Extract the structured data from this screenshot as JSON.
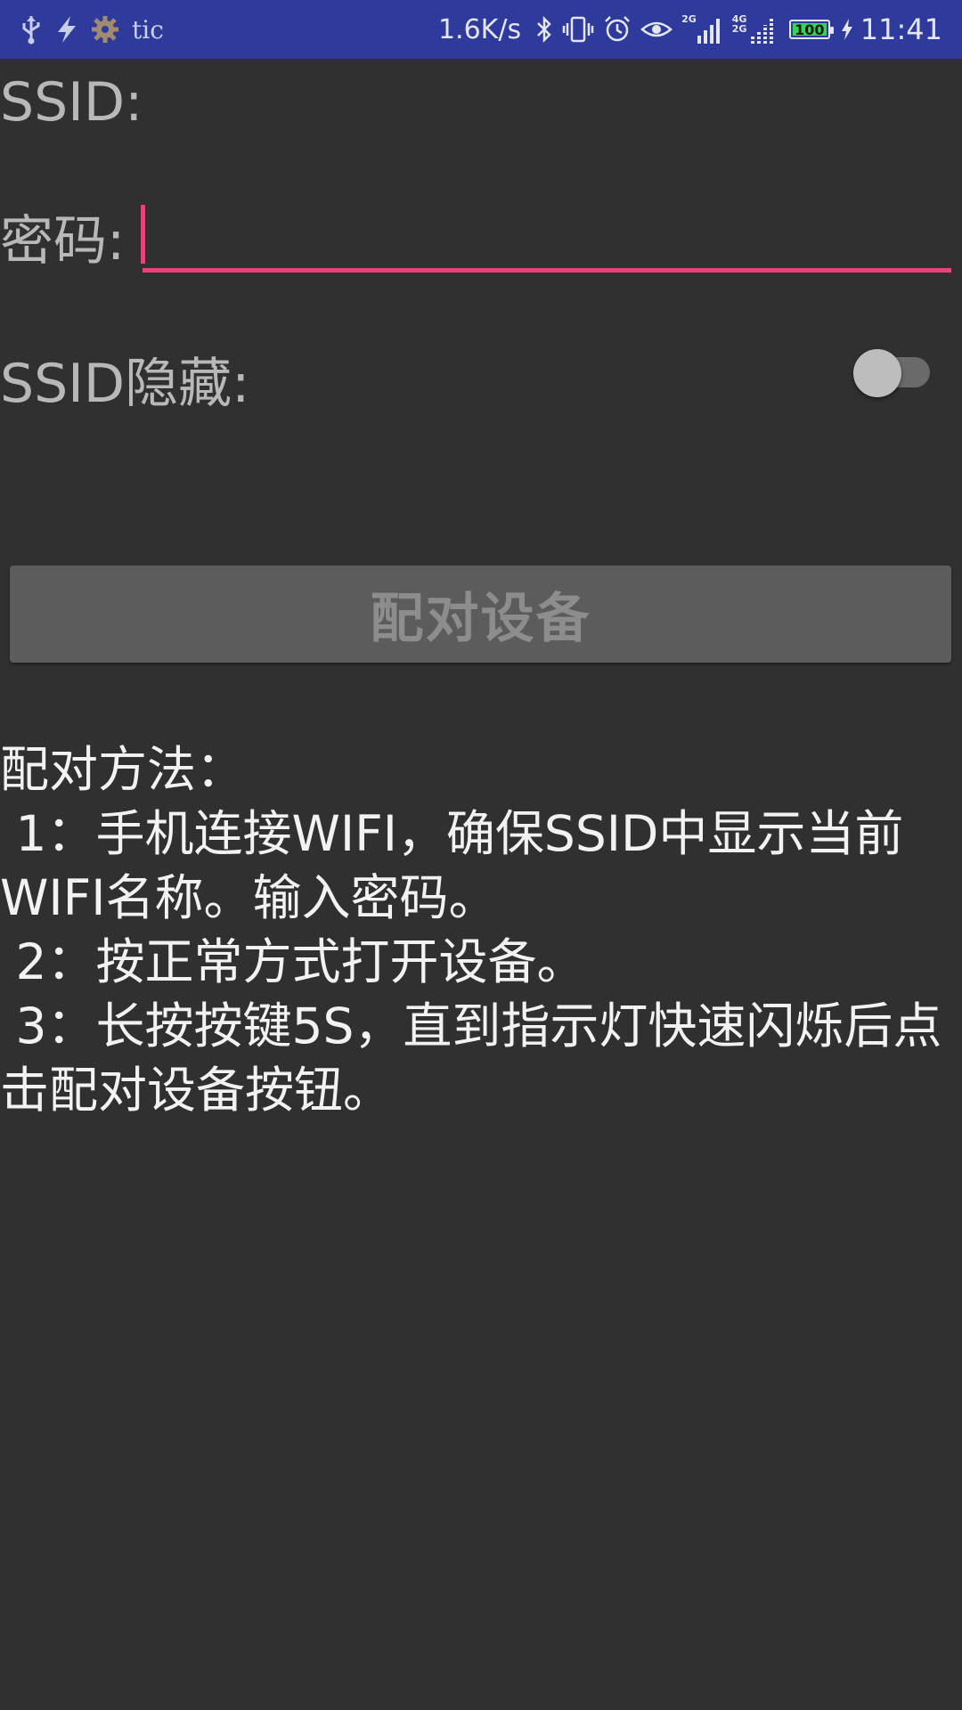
{
  "status_bar": {
    "left_icons": [
      "usb-icon",
      "flash-icon",
      "settings-gear-icon"
    ],
    "app_label": "tic",
    "net_speed": "1.6K/s",
    "right_icons": [
      "bluetooth-icon",
      "vibrate-icon",
      "alarm-icon",
      "eye-icon",
      "signal-2g-icon",
      "signal-4g-2g-icon"
    ],
    "signal1_tag": "2G",
    "signal2_tag": "4G 2G",
    "battery_level": "100",
    "battery_color": "#39d353",
    "time": "11:41"
  },
  "form": {
    "ssid_label": "SSID:",
    "ssid_value": "",
    "password_label": "密码:",
    "password_value": "",
    "hidden_ssid_label": "SSID隐藏:",
    "hidden_ssid_on": false,
    "pair_button_label": "配对设备"
  },
  "instructions": {
    "title": "配对方法：",
    "steps": [
      " 1：手机连接WIFI，确保SSID中显示当前WIFI名称。输入密码。",
      " 2：按正常方式打开设备。",
      " 3：长按按键5S，直到指示灯快速闪烁后点击配对设备按钮。"
    ]
  },
  "colors": {
    "status_bar_bg": "#2e3a9c",
    "background": "#303030",
    "accent": "#e8437a"
  }
}
